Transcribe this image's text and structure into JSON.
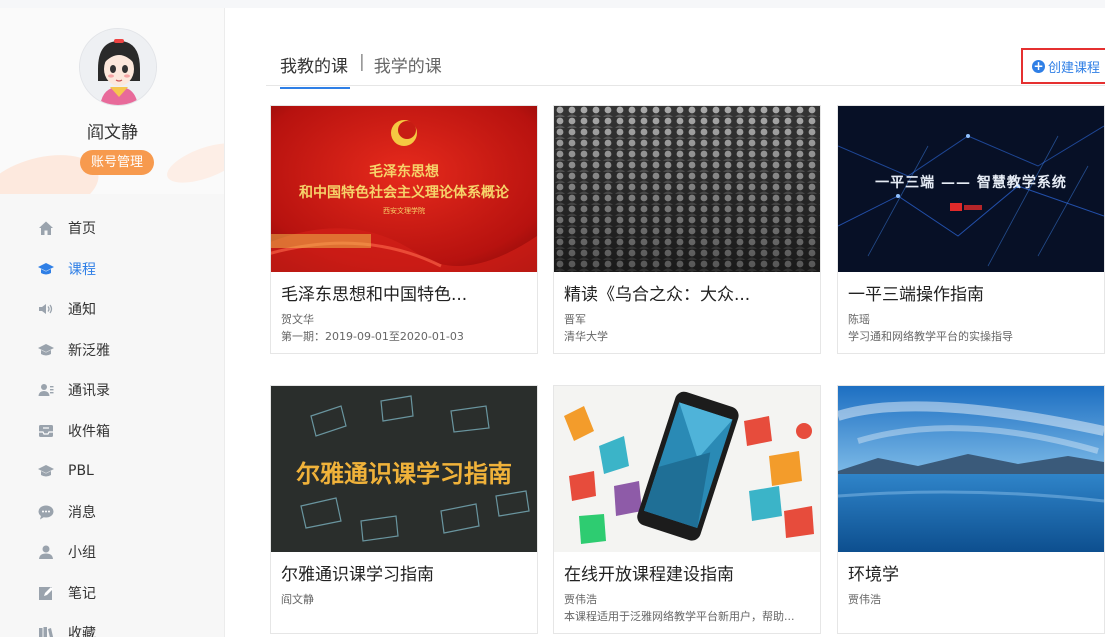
{
  "user": {
    "name": "阎文静",
    "account_button": "账号管理"
  },
  "nav": {
    "items": [
      {
        "label": "首页",
        "icon": "home-icon"
      },
      {
        "label": "课程",
        "icon": "course-icon",
        "active": true
      },
      {
        "label": "通知",
        "icon": "speaker-icon"
      },
      {
        "label": "新泛雅",
        "icon": "graduation-icon"
      },
      {
        "label": "通讯录",
        "icon": "contacts-icon"
      },
      {
        "label": "收件箱",
        "icon": "inbox-icon"
      },
      {
        "label": "PBL",
        "icon": "graduation-icon"
      },
      {
        "label": "消息",
        "icon": "chat-bubble-icon"
      },
      {
        "label": "小组",
        "icon": "person-icon"
      },
      {
        "label": "笔记",
        "icon": "edit-icon"
      },
      {
        "label": "收藏",
        "icon": "books-icon"
      }
    ]
  },
  "tabs": {
    "teaching": "我教的课",
    "separator": "|",
    "learning": "我学的课"
  },
  "create_button": {
    "label": "创建课程",
    "plus": "+"
  },
  "colors": {
    "accent": "#2f7fe6",
    "account_button": "#f79a4e",
    "highlight_border": "#e53030"
  },
  "courses": [
    {
      "title": "毛泽东思想和中国特色...",
      "teacher": "贺文华",
      "subtitle": "第一期：2019-09-01至2020-01-03",
      "cover_lines": [
        "毛泽东思想",
        "和中国特色社会主义理论体系概论"
      ],
      "cover_caption": "西安文理学院"
    },
    {
      "title": "精读《乌合之众：大众...",
      "teacher": "晋军",
      "subtitle": "清华大学"
    },
    {
      "title": "一平三端操作指南",
      "teacher": "陈瑶",
      "subtitle": "学习通和网络教学平台的实操指导",
      "cover_lines": [
        "一平三端 —— 智慧教学系统"
      ]
    },
    {
      "title": "尔雅通识课学习指南",
      "teacher": "阎文静",
      "subtitle": "",
      "cover_lines": [
        "尔雅通识课学习指南"
      ]
    },
    {
      "title": "在线开放课程建设指南",
      "teacher": "贾伟浩",
      "subtitle": "本课程适用于泛雅网络教学平台新用户，帮助..."
    },
    {
      "title": "环境学",
      "teacher": "贾伟浩",
      "subtitle": ""
    }
  ]
}
